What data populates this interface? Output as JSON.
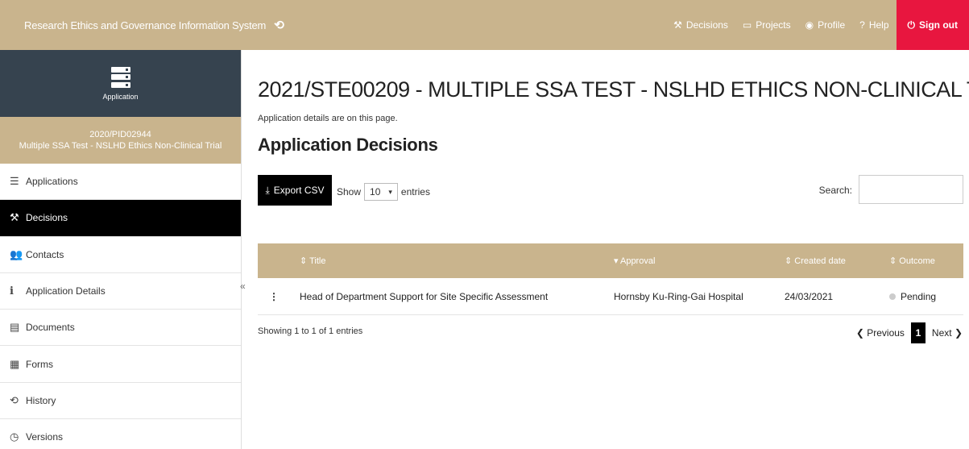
{
  "header": {
    "title": "Research Ethics and Governance Information System",
    "history_icon": "history-icon",
    "nav": [
      {
        "label": "Decisions",
        "icon": "gavel-icon"
      },
      {
        "label": "Projects",
        "icon": "monitor-icon"
      },
      {
        "label": "Profile",
        "icon": "user-circle-icon"
      },
      {
        "label": "Help",
        "icon": "question-icon"
      },
      {
        "label": "Sign out",
        "icon": "power-icon"
      }
    ]
  },
  "sidebar": {
    "app_label": "Application",
    "project_id": "2020/PID02944",
    "project_name": "Multiple SSA Test - NSLHD Ethics Non-Clinical Trial",
    "items": [
      {
        "label": "Applications",
        "icon": "server-icon"
      },
      {
        "label": "Decisions",
        "icon": "gavel-icon"
      },
      {
        "label": "Contacts",
        "icon": "users-icon"
      },
      {
        "label": "Application Details",
        "icon": "info-icon"
      },
      {
        "label": "Documents",
        "icon": "document-icon"
      },
      {
        "label": "Forms",
        "icon": "form-icon"
      },
      {
        "label": "History",
        "icon": "history-icon"
      },
      {
        "label": "Versions",
        "icon": "clock-icon"
      }
    ],
    "collapse_glyph": "«"
  },
  "main": {
    "page_title": "2021/STE00209 - MULTIPLE SSA TEST - NSLHD ETHICS NON-CLINICAL T...",
    "subtext": "Application details are on this page.",
    "section_title": "Application Decisions",
    "export_label": "Export CSV",
    "show_label": "Show",
    "entries_value": "10",
    "entries_label": "entries",
    "search_label": "Search:",
    "search_value": ""
  },
  "table": {
    "columns": [
      "Title",
      "Approval",
      "Created date",
      "Outcome"
    ],
    "rows": [
      {
        "title": "Head of Department Support for Site Specific Assessment",
        "approval": "Hornsby Ku-Ring-Gai Hospital",
        "created": "24/03/2021",
        "outcome": "Pending"
      }
    ],
    "info": "Showing 1 to 1 of 1 entries",
    "previous": "Previous",
    "current_page": "1",
    "next": "Next"
  },
  "colors": {
    "brand": "#c9b48d",
    "sidebar_dark": "#36434f",
    "signout": "#e8163f",
    "active": "#000000"
  }
}
